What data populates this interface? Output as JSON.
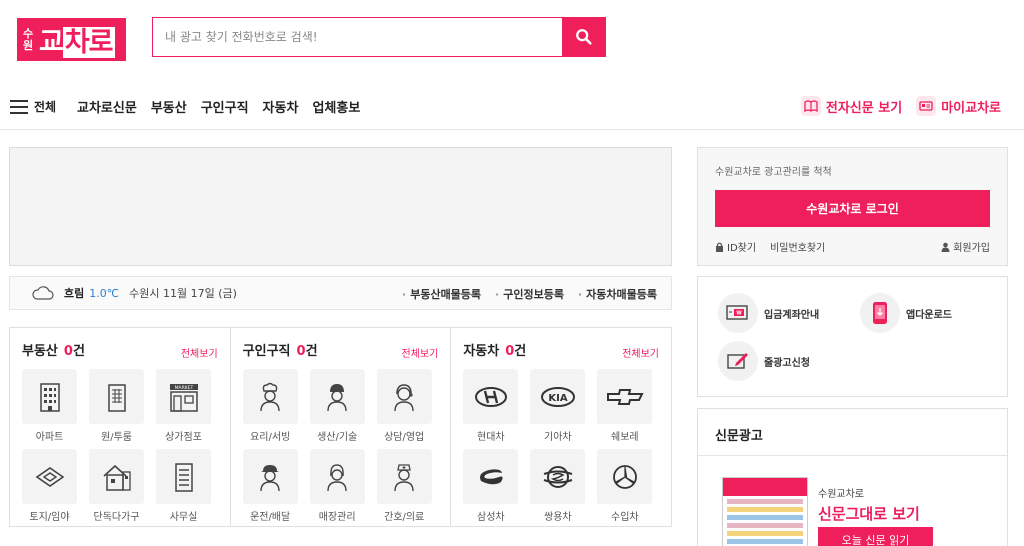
{
  "header": {
    "logo_small": "수원",
    "logo_main": "교",
    "logo_highlight": "차로",
    "search_placeholder": "내 광고 찾기 전화번호로 검색!"
  },
  "nav": {
    "all_label": "전체",
    "items": [
      "교차로신문",
      "부동산",
      "구인구직",
      "자동차",
      "업체홍보"
    ],
    "right": [
      "전자신문 보기",
      "마이교차로"
    ]
  },
  "weather": {
    "condition": "흐림",
    "temp": "1.0℃",
    "location_date": "수원시 11월 17일 (금)",
    "links": [
      "부동산매물등록",
      "구인정보등록",
      "자동차매물등록"
    ]
  },
  "categories": [
    {
      "title": "부동산",
      "count": "0",
      "unit": "건",
      "more": "전체보기",
      "items": [
        {
          "label": "아파트",
          "icon": "apartment-icon"
        },
        {
          "label": "원/투룸",
          "icon": "building-icon"
        },
        {
          "label": "상가점포",
          "icon": "market-icon"
        },
        {
          "label": "토지/임야",
          "icon": "land-icon"
        },
        {
          "label": "단독다가구",
          "icon": "house-icon"
        },
        {
          "label": "사무실",
          "icon": "office-icon"
        }
      ]
    },
    {
      "title": "구인구직",
      "count": "0",
      "unit": "건",
      "more": "전체보기",
      "items": [
        {
          "label": "요리/서빙",
          "icon": "chef-icon"
        },
        {
          "label": "생산/기술",
          "icon": "worker-icon"
        },
        {
          "label": "상담/영업",
          "icon": "headset-icon"
        },
        {
          "label": "운전/배달",
          "icon": "driver-icon"
        },
        {
          "label": "매장관리",
          "icon": "staff-icon"
        },
        {
          "label": "간호/의료",
          "icon": "nurse-icon"
        }
      ]
    },
    {
      "title": "자동차",
      "count": "0",
      "unit": "건",
      "more": "전체보기",
      "items": [
        {
          "label": "현대차",
          "icon": "hyundai-icon"
        },
        {
          "label": "기아차",
          "icon": "kia-icon"
        },
        {
          "label": "쉐보레",
          "icon": "chevrolet-icon"
        },
        {
          "label": "삼성차",
          "icon": "samsung-icon"
        },
        {
          "label": "쌍용차",
          "icon": "ssangyong-icon"
        },
        {
          "label": "수입차",
          "icon": "import-car-icon"
        }
      ]
    }
  ],
  "login": {
    "message": "수원교차로 광고관리를 척척",
    "button": "수원교차로 로그인",
    "find_id": "ID찾기",
    "find_pw": "비밀번호찾기",
    "join": "회원가입"
  },
  "services": {
    "account": "입금계좌안내",
    "app": "앱다운로드",
    "line_ad": "줄광고신청"
  },
  "paper": {
    "heading": "신문광고",
    "sub": "수원교차로",
    "big": "신문그대로 보기",
    "button": "오늘 신문 읽기"
  },
  "colors": {
    "accent": "#ee1f5b"
  }
}
